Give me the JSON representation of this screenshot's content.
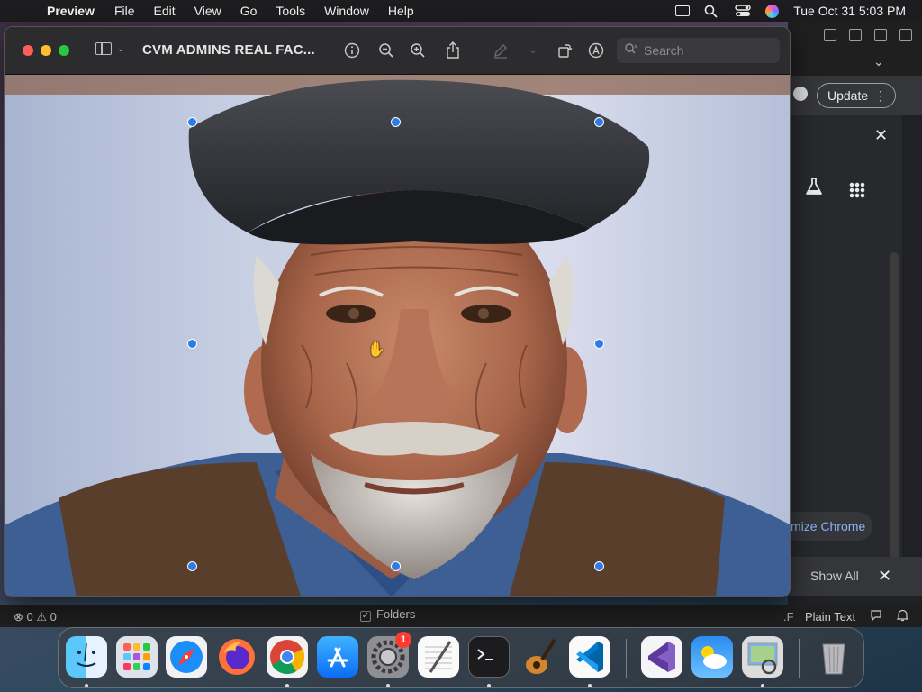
{
  "menubar": {
    "app": "Preview",
    "items": [
      "File",
      "Edit",
      "View",
      "Go",
      "Tools",
      "Window",
      "Help"
    ],
    "datetime": "Tue Oct 31  5:03 PM"
  },
  "preview": {
    "title": "CVM ADMINS REAL FAC...",
    "search_placeholder": "Search"
  },
  "chrome": {
    "update_label": "Update",
    "customize_label": "mize Chrome",
    "show_all_label": "Show All"
  },
  "vscode": {
    "errors": "⊗ 0 ⚠ 0",
    "folders_label": "Folders",
    "folders_checked": true,
    "f_label": ".F",
    "language": "Plain Text"
  },
  "dock": {
    "apps": [
      "Finder",
      "Launchpad",
      "Safari",
      "Firefox",
      "Chrome",
      "App Store",
      "System Settings",
      "TextEdit",
      "Terminal",
      "GarageBand",
      "Visual Studio Code",
      "Visual Studio",
      "Weather",
      "Preview",
      "Trash"
    ],
    "settings_badge": "1"
  },
  "colors": {
    "accent": "#2f7ae5",
    "chrome_link": "#8ab4f8"
  }
}
